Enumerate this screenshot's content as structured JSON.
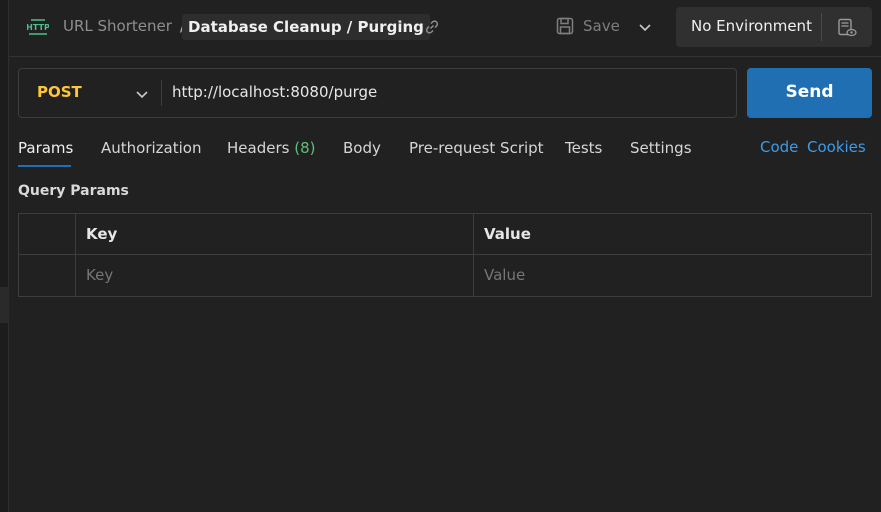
{
  "header": {
    "icon_text": "HTTP",
    "breadcrumb_parent": "URL Shortener",
    "breadcrumb_separator": "/",
    "request_name": "Database Cleanup / Purging",
    "save_label": "Save",
    "environment": "No Environment"
  },
  "request": {
    "method": "POST",
    "url": "http://localhost:8080/purge",
    "send_label": "Send"
  },
  "tabs": [
    {
      "label": "Params",
      "active": true
    },
    {
      "label": "Authorization"
    },
    {
      "label": "Headers",
      "count": "(8)"
    },
    {
      "label": "Body"
    },
    {
      "label": "Pre-request Script"
    },
    {
      "label": "Tests"
    },
    {
      "label": "Settings"
    }
  ],
  "right_links": {
    "code": "Code",
    "cookies": "Cookies"
  },
  "query_params": {
    "title": "Query Params",
    "columns": {
      "key": "Key",
      "value": "Value"
    },
    "placeholders": {
      "key": "Key",
      "value": "Value"
    }
  },
  "colors": {
    "background": "#212121",
    "method_post": "#ffc63a",
    "send_button": "#1f6fb2",
    "link": "#3d9be9",
    "count_green": "#5fbf7a"
  }
}
